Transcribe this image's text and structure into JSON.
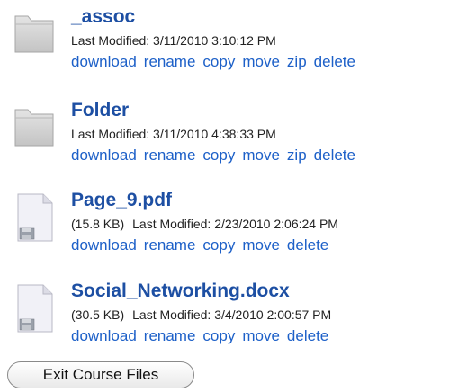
{
  "files": [
    {
      "name": "_assoc",
      "type": "folder",
      "size": "",
      "modified": "Last Modified: 3/11/2010 3:10:12 PM",
      "actions": [
        "download",
        "rename",
        "copy",
        "move",
        "zip",
        "delete"
      ]
    },
    {
      "name": "Folder",
      "type": "folder",
      "size": "",
      "modified": "Last Modified: 3/11/2010 4:38:33 PM",
      "actions": [
        "download",
        "rename",
        "copy",
        "move",
        "zip",
        "delete"
      ]
    },
    {
      "name": "Page_9.pdf",
      "type": "file",
      "size": "(15.8 KB)",
      "modified": "Last Modified: 2/23/2010 2:06:24 PM",
      "actions": [
        "download",
        "rename",
        "copy",
        "move",
        "delete"
      ]
    },
    {
      "name": "Social_Networking.docx",
      "type": "file",
      "size": "(30.5 KB)",
      "modified": "Last Modified: 3/4/2010 2:00:57 PM",
      "actions": [
        "download",
        "rename",
        "copy",
        "move",
        "delete"
      ]
    }
  ],
  "exit_button": "Exit Course Files",
  "colors": {
    "name_link": "#1d4fa3",
    "action_link": "#1d60c8",
    "meta_text": "#222222"
  },
  "icons": {
    "folder": "folder-icon",
    "file": "file-icon"
  }
}
